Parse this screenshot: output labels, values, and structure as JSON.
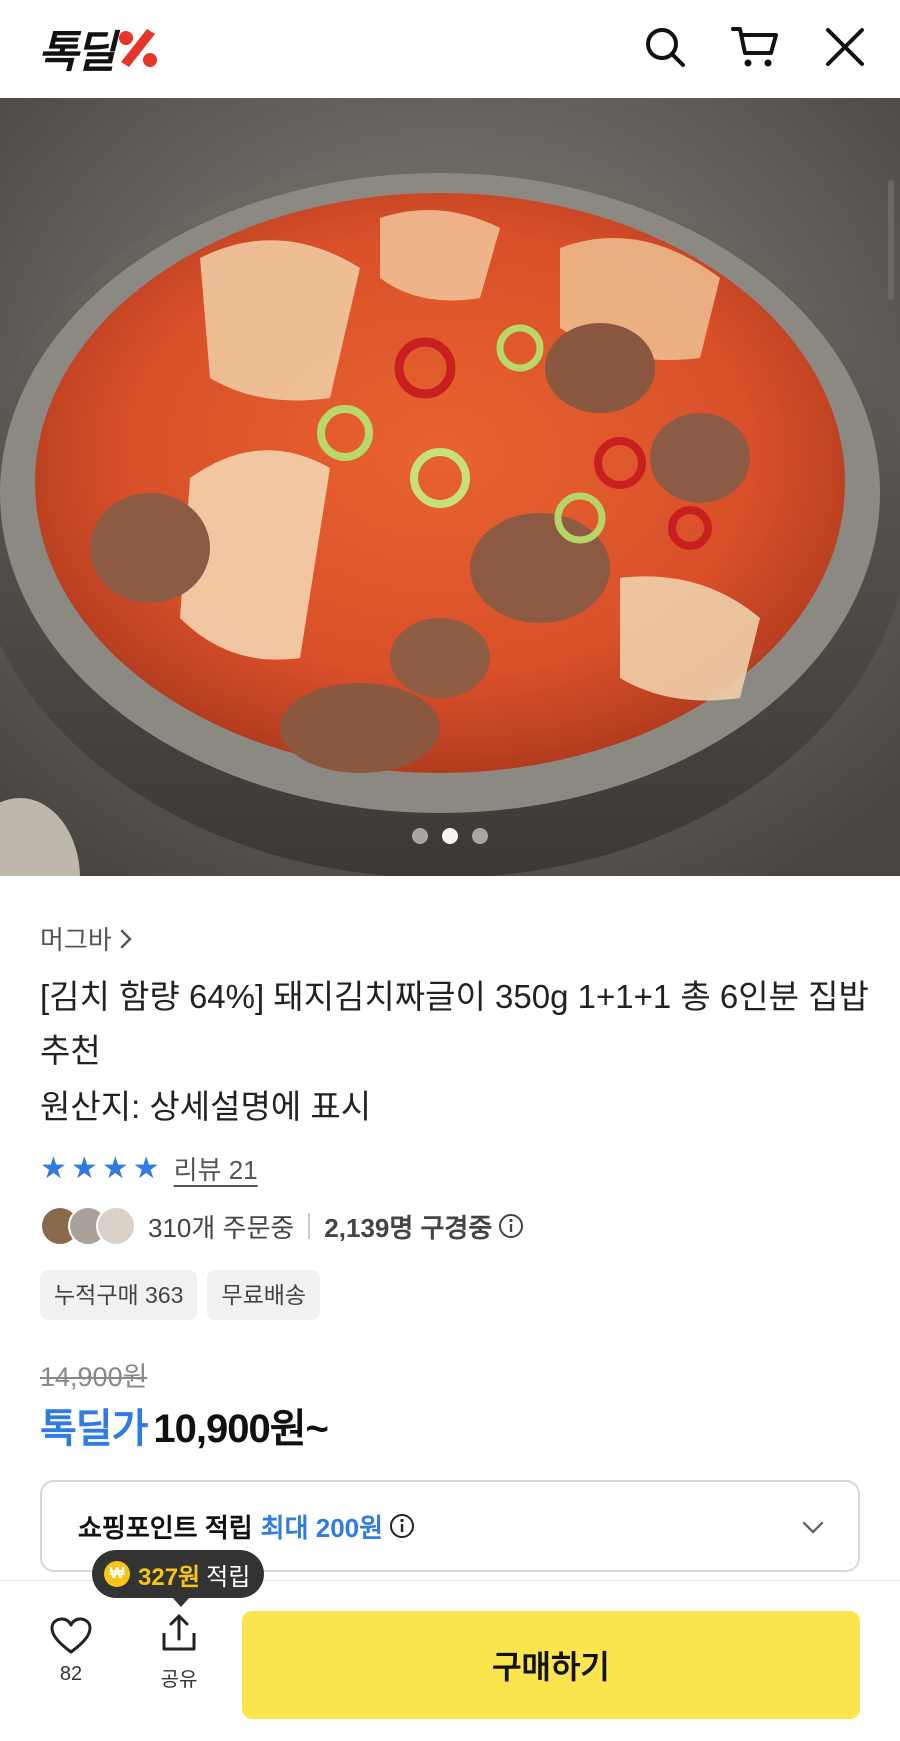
{
  "header": {
    "logo_text": "톡딜",
    "logo_icon": "percent-logo-icon",
    "search_icon": "search-icon",
    "cart_icon": "cart-icon",
    "close_icon": "close-icon",
    "accent_color": "#e8352b"
  },
  "hero": {
    "image_subject": "kimchi pork stew in a stone bowl",
    "carousel_total": 3,
    "carousel_active": 2
  },
  "product": {
    "seller": "머그바",
    "seller_chevron_icon": "chevron-right-icon",
    "title": "[김치 함량 64%] 돼지김치짜글이 350g 1+1+1 총 6인분 집밥 추천",
    "origin": "원산지: 상세설명에 표시",
    "rating_stars": 4,
    "review_link": "리뷰 21",
    "orders_text": "310개 주문중",
    "watching_text": "2,139명 구경중",
    "tags": [
      "누적구매 363",
      "무료배송"
    ],
    "original_price": "14,900원",
    "price_label": "톡딜가",
    "price_value": "10,900원~",
    "star_color": "#2f7be2"
  },
  "points": {
    "label": "쇼핑포인트 적립",
    "max": "최대 200원",
    "info_icon": "info-icon",
    "chevron_icon": "chevron-down-icon"
  },
  "bottom_bar": {
    "like_count": "82",
    "share_label": "공유",
    "buy_label": "구매하기",
    "buy_color": "#fbe54e",
    "tooltip_amount": "327원",
    "tooltip_text": "적립",
    "coin_symbol": "₩"
  }
}
